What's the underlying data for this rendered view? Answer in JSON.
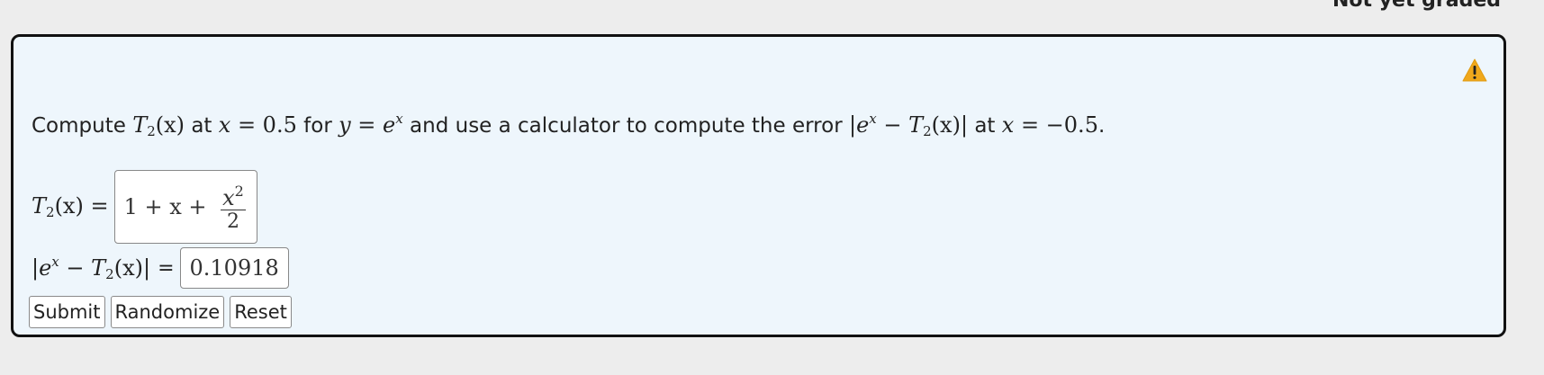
{
  "header": {
    "grade_status": "Not yet graded"
  },
  "problem": {
    "warning_icon": "warning-triangle-icon",
    "statement": {
      "p1": "Compute ",
      "p2": " at ",
      "p3": " for ",
      "p4": " and use a calculator to compute the error ",
      "p5": " at ",
      "p6": "."
    },
    "math": {
      "T": "T",
      "sub2": "2",
      "x_arg": "(x)",
      "x": "x",
      "eq_half": " = 0.5",
      "y": "y",
      "eq": " = ",
      "e": "e",
      "x_sup": "x",
      "abs_open": "|",
      "minus": " − ",
      "abs_close": "|",
      "eq_neg_half": " = −0.5"
    },
    "answer1": {
      "label_tail": " =",
      "expr_prefix": "1 + x + ",
      "frac_num_base": "x",
      "frac_num_sup": "2",
      "frac_den": "2"
    },
    "answer2": {
      "equals": "=",
      "value": "0.10918"
    }
  },
  "buttons": {
    "submit": "Submit",
    "randomize": "Randomize",
    "reset": "Reset"
  },
  "colors": {
    "card_background": "#eef6fc",
    "page_background": "#ededed",
    "warning": "#f0a81c"
  }
}
